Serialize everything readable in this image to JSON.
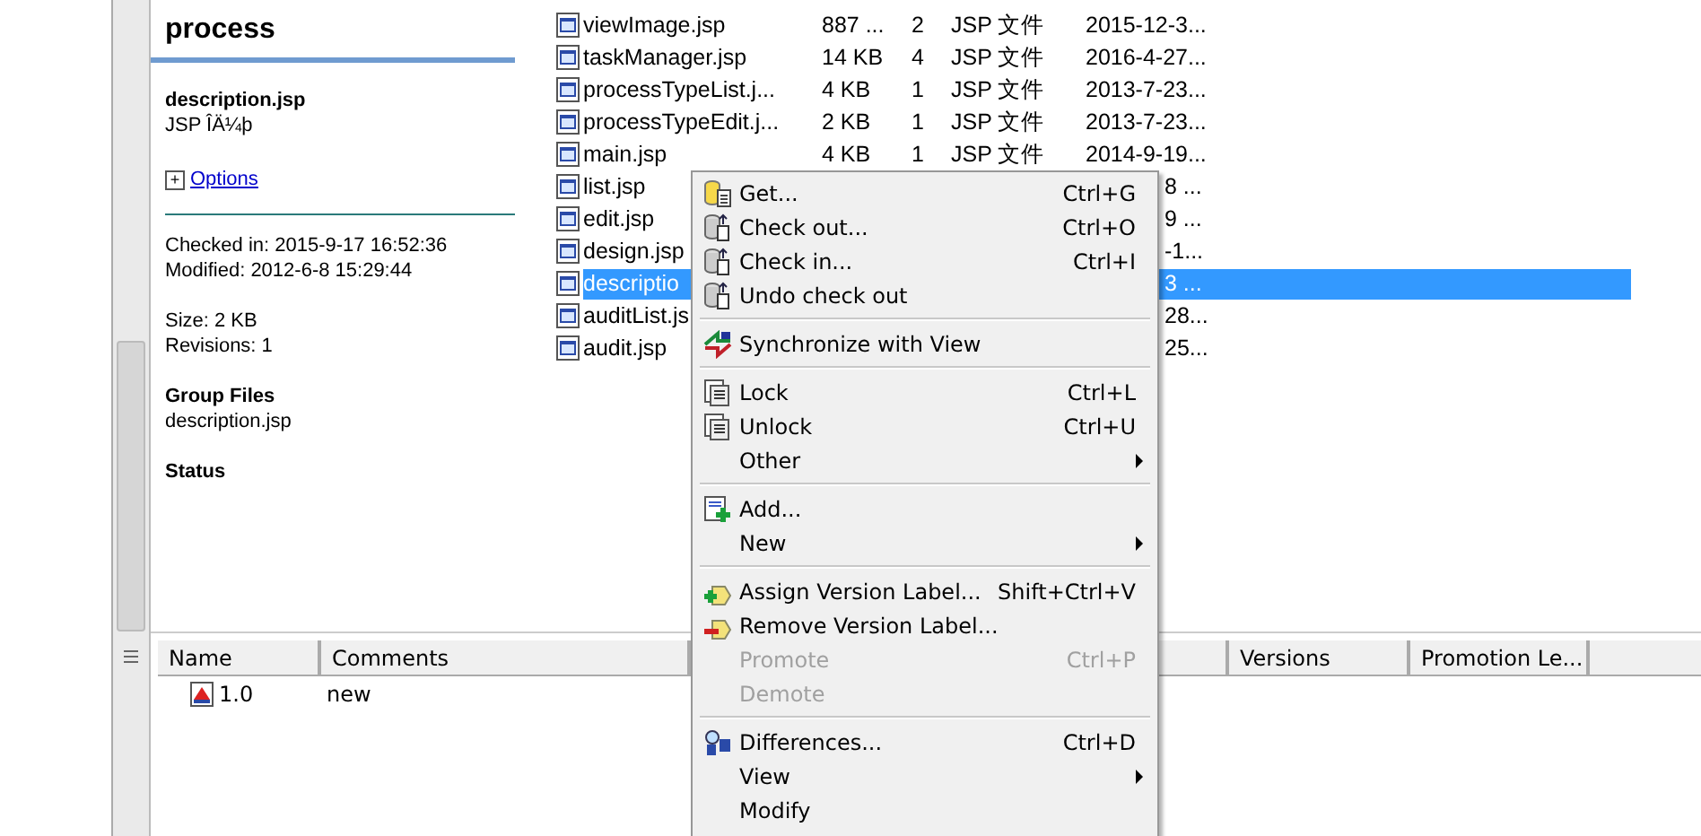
{
  "info_panel": {
    "title": "process",
    "file_name": "description.jsp",
    "file_type": "JSP ÎÄ¼þ",
    "options": {
      "expander": "+",
      "label": "Options",
      "expanded": false
    },
    "details": [
      "Checked in: 2015-9-17 16:52:36",
      "Modified: 2012-6-8 15:29:44"
    ],
    "stats": [
      "Size: 2 KB",
      "Revisions: 1"
    ],
    "group_files": {
      "heading": "Group Files",
      "items": [
        "description.jsp"
      ]
    },
    "status": {
      "heading": "Status"
    }
  },
  "file_list": {
    "rows": [
      {
        "name": "viewImage.jsp",
        "size": "887 ...",
        "versions": "2",
        "type": "JSP 文件",
        "date": "2015-12-3...",
        "selected": false
      },
      {
        "name": "taskManager.jsp",
        "size": "14 KB",
        "versions": "4",
        "type": "JSP 文件",
        "date": "2016-4-27...",
        "selected": false
      },
      {
        "name": "processTypeList.j...",
        "size": "4 KB",
        "versions": "1",
        "type": "JSP 文件",
        "date": "2013-7-23...",
        "selected": false
      },
      {
        "name": "processTypeEdit.j...",
        "size": "2 KB",
        "versions": "1",
        "type": "JSP 文件",
        "date": "2013-7-23...",
        "selected": false
      },
      {
        "name": "main.jsp",
        "size": "4 KB",
        "versions": "1",
        "type": "JSP 文件",
        "date": "2014-9-19...",
        "selected": false
      },
      {
        "name": "list.jsp",
        "date_tail": "8 ...",
        "selected": false
      },
      {
        "name": "edit.jsp",
        "date_tail": "9 ...",
        "selected": false
      },
      {
        "name": "design.jsp",
        "date_tail": "-1...",
        "selected": false
      },
      {
        "name": "descriptio",
        "date_tail": "3 ...",
        "selected": true
      },
      {
        "name": "auditList.js",
        "date_tail": "28...",
        "selected": false
      },
      {
        "name": "audit.jsp",
        "date_tail": "25...",
        "selected": false
      }
    ]
  },
  "history": {
    "columns": [
      "Name",
      "Comments",
      "Versions",
      "Promotion Le..."
    ],
    "rows": [
      {
        "name": "1.0",
        "comment": "new"
      }
    ]
  },
  "context_menu": {
    "items": [
      {
        "kind": "item",
        "label": "Get...",
        "shortcut": "Ctrl+G",
        "disabled": false,
        "submenu": false
      },
      {
        "kind": "item",
        "label": "Check out...",
        "shortcut": "Ctrl+O",
        "disabled": false,
        "submenu": false
      },
      {
        "kind": "item",
        "label": "Check in...",
        "shortcut": "Ctrl+I",
        "disabled": false,
        "submenu": false
      },
      {
        "kind": "item",
        "label": "Undo check out",
        "disabled": false,
        "submenu": false
      },
      {
        "kind": "separator"
      },
      {
        "kind": "item",
        "label": "Synchronize with View",
        "disabled": false,
        "submenu": false
      },
      {
        "kind": "separator"
      },
      {
        "kind": "item",
        "label": "Lock",
        "shortcut": "Ctrl+L",
        "disabled": false,
        "submenu": false
      },
      {
        "kind": "item",
        "label": "Unlock",
        "shortcut": "Ctrl+U",
        "disabled": false,
        "submenu": false
      },
      {
        "kind": "item",
        "label": "Other",
        "disabled": false,
        "submenu": true
      },
      {
        "kind": "separator"
      },
      {
        "kind": "item",
        "label": "Add...",
        "disabled": false,
        "submenu": false
      },
      {
        "kind": "item",
        "label": "New",
        "disabled": false,
        "submenu": true
      },
      {
        "kind": "separator"
      },
      {
        "kind": "item",
        "label": "Assign Version Label...",
        "shortcut": "Shift+Ctrl+V",
        "disabled": false,
        "submenu": false
      },
      {
        "kind": "item",
        "label": "Remove Version Label...",
        "disabled": false,
        "submenu": false
      },
      {
        "kind": "item",
        "label": "Promote",
        "shortcut": "Ctrl+P",
        "disabled": true,
        "submenu": false
      },
      {
        "kind": "item",
        "label": "Demote",
        "disabled": true,
        "submenu": false
      },
      {
        "kind": "separator"
      },
      {
        "kind": "item",
        "label": "Differences...",
        "shortcut": "Ctrl+D",
        "disabled": false,
        "submenu": false
      },
      {
        "kind": "item",
        "label": "View",
        "disabled": false,
        "submenu": true
      },
      {
        "kind": "item",
        "label": "Modify",
        "disabled": false,
        "submenu": false
      }
    ]
  }
}
